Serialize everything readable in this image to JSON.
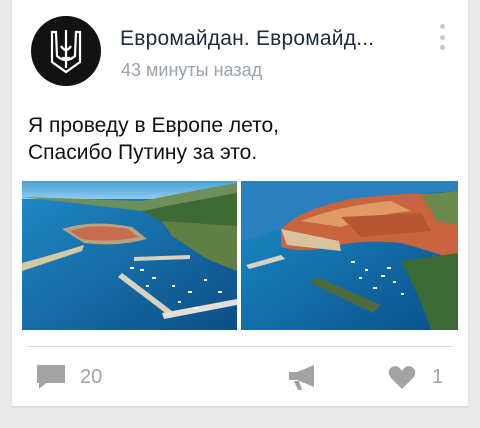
{
  "post": {
    "author": "Евромайдан. Евромайд...",
    "time": "43 минуты назад",
    "text_lines": [
      "Я проведу в Европе лето,",
      "Спасибо Путину за это."
    ]
  },
  "icons": {
    "avatar": "ukraine-trident-icon",
    "menu": "more-vertical-icon",
    "comment": "comment-icon",
    "share": "megaphone-icon",
    "like": "heart-icon"
  },
  "actions": {
    "comments_count": "20",
    "likes_count": "1"
  },
  "colors": {
    "card": "#ffffff",
    "background": "#e9e9e9",
    "title": "#1c2a3a",
    "muted": "#9aa3ab",
    "icon": "#a3a3a3"
  }
}
